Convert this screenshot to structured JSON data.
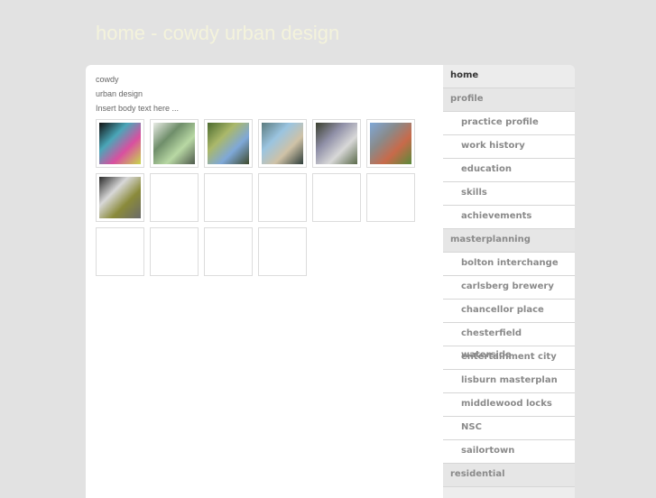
{
  "header": {
    "title": "home - cowdy urban design"
  },
  "main": {
    "lines": [
      "cowdy",
      "urban design",
      "Insert body text here ..."
    ],
    "gallery": {
      "thumbnails": [
        {
          "name": "thumb-1",
          "has_image": true,
          "colors": [
            "#111111",
            "#4aa6b8",
            "#d94fa0",
            "#c8d84a"
          ]
        },
        {
          "name": "thumb-2",
          "has_image": true,
          "colors": [
            "#e9ece6",
            "#6f8e6a",
            "#b8d8a4",
            "#4e5a4c"
          ]
        },
        {
          "name": "thumb-3",
          "has_image": true,
          "colors": [
            "#4b6a2e",
            "#aab86a",
            "#7fa8d8",
            "#3e4a2c"
          ]
        },
        {
          "name": "thumb-4",
          "has_image": true,
          "colors": [
            "#5b7b7e",
            "#9bc4e0",
            "#cfc2a6",
            "#2e3d3a"
          ]
        },
        {
          "name": "thumb-5",
          "has_image": true,
          "colors": [
            "#3a3f2e",
            "#9090a8",
            "#d8d8d8",
            "#5a6a4a"
          ]
        },
        {
          "name": "thumb-6",
          "has_image": true,
          "colors": [
            "#7fa8d8",
            "#8a8a8a",
            "#c86a4a",
            "#5a8a3a"
          ]
        },
        {
          "name": "thumb-7",
          "has_image": true,
          "colors": [
            "#2a2a2a",
            "#d8d8d8",
            "#8a8a3a",
            "#6a6a6a"
          ]
        },
        {
          "name": "thumb-8",
          "has_image": false
        },
        {
          "name": "thumb-9",
          "has_image": false
        },
        {
          "name": "thumb-10",
          "has_image": false
        },
        {
          "name": "thumb-11",
          "has_image": false
        },
        {
          "name": "thumb-12",
          "has_image": false
        },
        {
          "name": "thumb-13",
          "has_image": false
        },
        {
          "name": "thumb-14",
          "has_image": false
        },
        {
          "name": "thumb-15",
          "has_image": false
        },
        {
          "name": "thumb-16",
          "has_image": false
        }
      ]
    }
  },
  "sidebar": {
    "items": [
      {
        "label": "home",
        "type": "section",
        "active": true
      },
      {
        "label": "profile",
        "type": "section"
      },
      {
        "label": "practice profile",
        "type": "sub"
      },
      {
        "label": "work history",
        "type": "sub"
      },
      {
        "label": "education",
        "type": "sub"
      },
      {
        "label": "skills",
        "type": "sub"
      },
      {
        "label": "achievements",
        "type": "sub"
      },
      {
        "label": "masterplanning",
        "type": "section"
      },
      {
        "label": "bolton interchange",
        "type": "sub"
      },
      {
        "label": "carlsberg brewery",
        "type": "sub"
      },
      {
        "label": "chancellor place",
        "type": "sub"
      },
      {
        "label": "chesterfield waterside",
        "type": "sub"
      },
      {
        "label": "entertainment city",
        "type": "sub"
      },
      {
        "label": "lisburn masterplan",
        "type": "sub"
      },
      {
        "label": "middlewood locks",
        "type": "sub"
      },
      {
        "label": "NSC",
        "type": "sub"
      },
      {
        "label": "sailortown",
        "type": "sub"
      },
      {
        "label": "residential",
        "type": "section"
      }
    ]
  }
}
